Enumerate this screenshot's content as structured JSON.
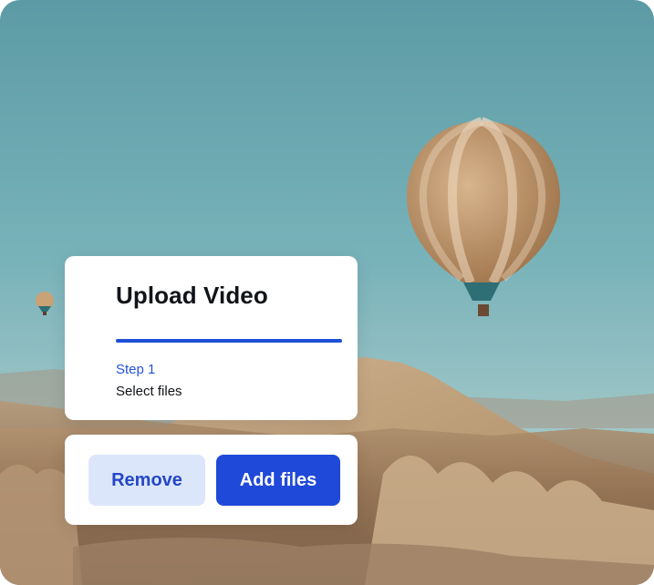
{
  "upload": {
    "title": "Upload Video",
    "progress_fraction": 1.0,
    "step_label": "Step 1",
    "step_description": "Select files"
  },
  "actions": {
    "remove_label": "Remove",
    "add_label": "Add files"
  },
  "colors": {
    "accent": "#1f4fd6",
    "remove_bg": "#dce6fb",
    "add_bg": "#1f49d8"
  }
}
